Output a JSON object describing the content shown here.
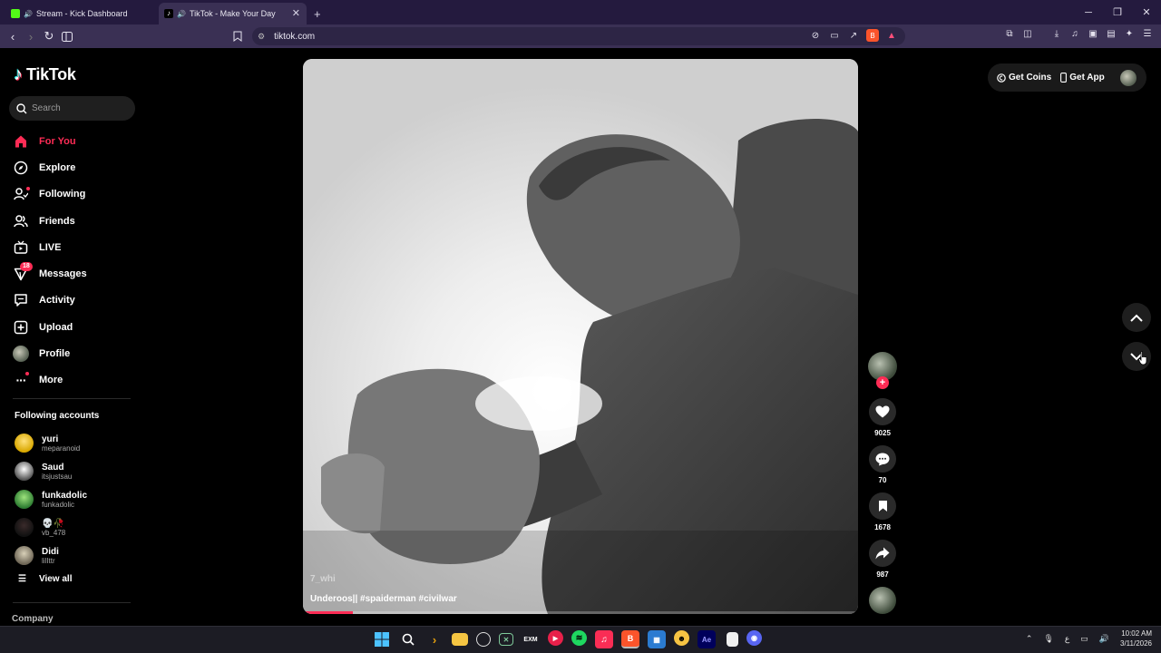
{
  "browser": {
    "tabs": [
      {
        "title": "Stream - Kick Dashboard",
        "active": false,
        "favicon_color": "#53fc18"
      },
      {
        "title": "TikTok - Make Your Day",
        "active": true,
        "favicon_color": "#ffffff"
      }
    ],
    "url": "tiktok.com"
  },
  "sidebar": {
    "logo": "TikTok",
    "search_placeholder": "Search",
    "nav": [
      {
        "label": "For You",
        "icon": "home-icon",
        "active": true
      },
      {
        "label": "Explore",
        "icon": "compass-icon"
      },
      {
        "label": "Following",
        "icon": "following-icon"
      },
      {
        "label": "Friends",
        "icon": "friends-icon"
      },
      {
        "label": "LIVE",
        "icon": "live-icon"
      },
      {
        "label": "Messages",
        "icon": "messages-icon",
        "badge": "18"
      },
      {
        "label": "Activity",
        "icon": "activity-icon"
      },
      {
        "label": "Upload",
        "icon": "upload-icon"
      },
      {
        "label": "Profile",
        "icon": "avatar"
      },
      {
        "label": "More",
        "icon": "more-icon"
      }
    ],
    "following_title": "Following accounts",
    "accounts": [
      {
        "name": "yuri",
        "username": "meparanoid",
        "color": "#f5d36b"
      },
      {
        "name": "Saud",
        "username": "itsjustsau",
        "color": "#cfcfcf"
      },
      {
        "name": "funkadolic",
        "username": "funkadolic",
        "color": "#4caf50"
      },
      {
        "name": "💀🥀",
        "username": "vb_478",
        "color": "#2a2a2a"
      },
      {
        "name": "Didi",
        "username": "lilIttr",
        "color": "#9a9480"
      }
    ],
    "view_all": "View all",
    "company": "Company"
  },
  "video": {
    "author": "7_whi",
    "caption": "Underoos|| #spaiderman #civilwar",
    "progress": 0.09
  },
  "actions": {
    "likes": "9025",
    "comments": "70",
    "saves": "1678",
    "shares": "987"
  },
  "topbar": {
    "get_coins": "Get Coins",
    "get_app": "Get App"
  },
  "taskbar": {
    "time": "10:02 AM",
    "date": "3/11/2026"
  }
}
